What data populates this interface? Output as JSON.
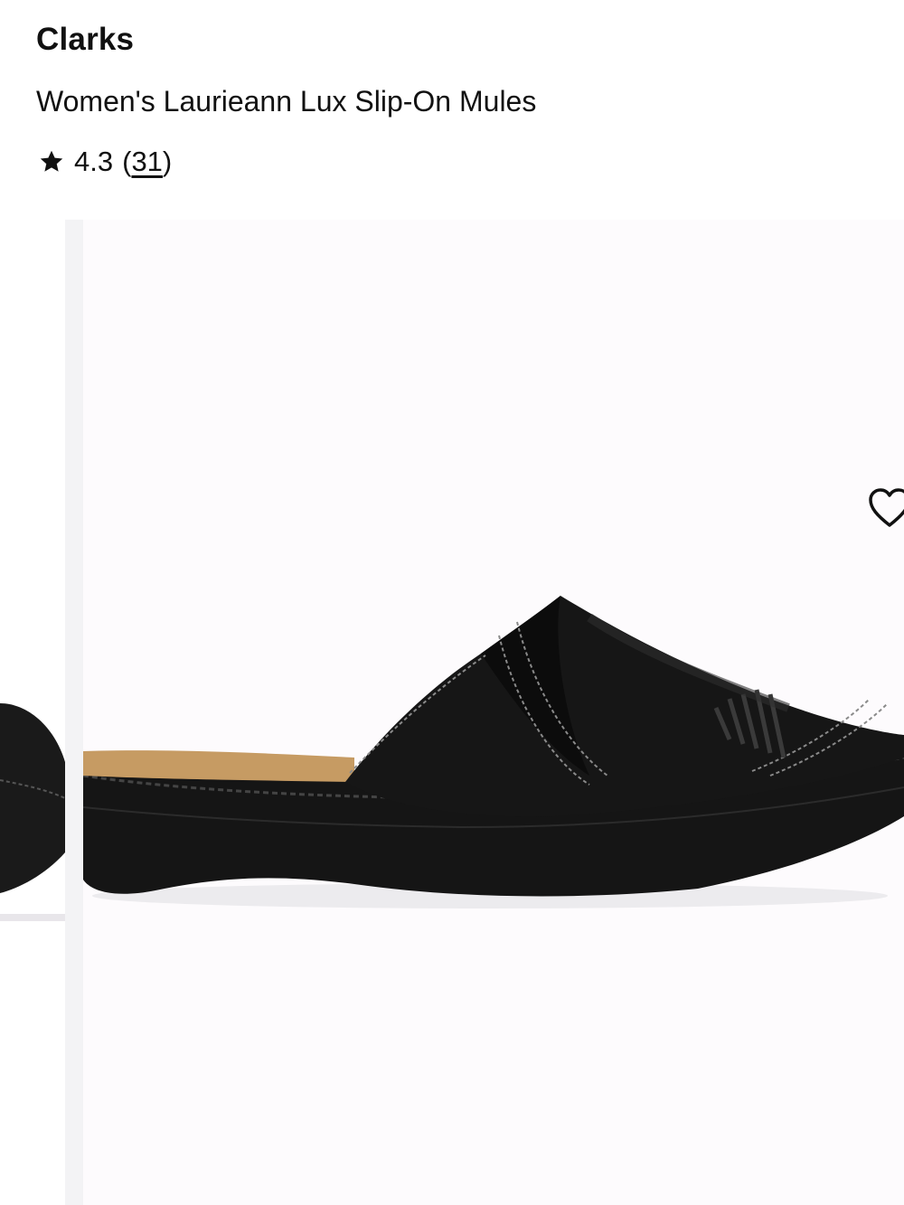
{
  "product": {
    "brand": "Clarks",
    "title": "Women's Laurieann Lux Slip-On Mules",
    "rating": "4.3",
    "review_count_open": "(",
    "review_count": "31",
    "review_count_close": ")"
  },
  "icons": {
    "rating": "star-icon",
    "favorite": "heart-outline-icon"
  },
  "colors": {
    "text": "#111111",
    "image_background": "#fdfbfd",
    "divider": "#f3f3f5"
  }
}
